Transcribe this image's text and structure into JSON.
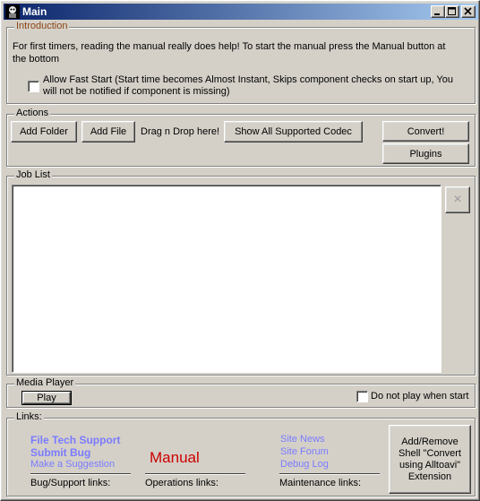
{
  "window": {
    "title": "Main",
    "minimize": "_",
    "maximize": "□",
    "close": "×"
  },
  "intro": {
    "title": "Introduction",
    "text": "For first timers, reading the manual really does help! To start the manual press the Manual button at the bottom",
    "fast_start_label": "Allow Fast Start (Start time becomes Almost Instant, Skips component checks on start up, You will not be notified if component is missing)",
    "fast_start_checked": false
  },
  "actions": {
    "title": "Actions",
    "add_folder": "Add Folder",
    "add_file": "Add File",
    "drag_drop": "Drag n Drop here!",
    "show_codec": "Show All Supported Codec",
    "convert": "Convert!",
    "plugins": "Plugins"
  },
  "job_list": {
    "title": "Job List",
    "remove_icon": "×"
  },
  "media_player": {
    "title": "Media Player",
    "play": "Play",
    "no_play_label": "Do not play when start",
    "no_play_checked": false
  },
  "links": {
    "title": "Links:",
    "file_tech_support": "File Tech Support",
    "submit_bug": "Submit Bug",
    "make_suggestion": "Make a Suggestion",
    "bug_support_caption": "Bug/Support links:",
    "manual": "Manual",
    "operations_caption": "Operations links:",
    "site_news": "Site News",
    "site_forum": "Site Forum",
    "debug_log": "Debug Log",
    "maintenance_caption": "Maintenance links:",
    "shell_extension": "Add/Remove Shell \"Convert using Alltoavi\" Extension"
  },
  "colors": {
    "link": "#7b7bff",
    "manual": "#cc0000",
    "intro_title": "#8b4513"
  }
}
